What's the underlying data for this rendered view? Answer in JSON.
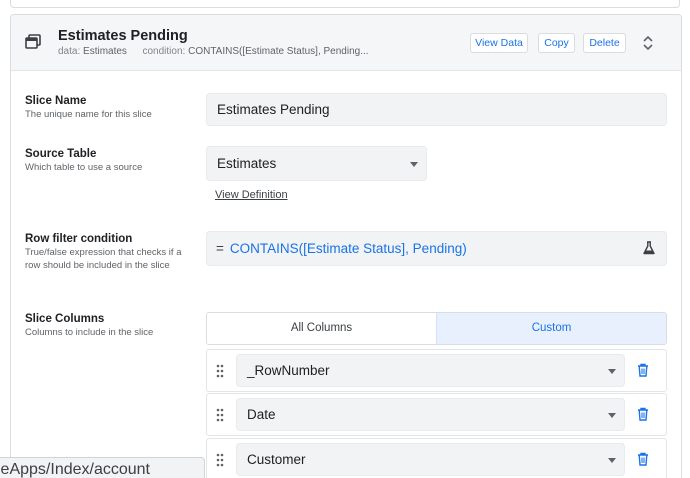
{
  "header": {
    "title": "Estimates Pending",
    "data_label": "data:",
    "data_value": "Estimates",
    "condition_label": "condition:",
    "condition_value": "CONTAINS([Estimate Status], Pending...",
    "buttons": {
      "view_data": "View Data",
      "copy": "Copy",
      "delete": "Delete"
    },
    "icons": {
      "slice": "slice-stack-icon",
      "expand": "unfold-icon"
    }
  },
  "fields": {
    "slice_name": {
      "label": "Slice Name",
      "hint": "The unique name for this slice",
      "value": "Estimates Pending"
    },
    "source_table": {
      "label": "Source Table",
      "hint": "Which table to use a source",
      "value": "Estimates",
      "link": "View Definition"
    },
    "row_filter": {
      "label": "Row filter condition",
      "hint": "True/false expression that checks if a row should be included in the slice",
      "prefix": "=",
      "value": "CONTAINS([Estimate Status], Pending)",
      "icon": "flask-icon"
    },
    "slice_columns": {
      "label": "Slice Columns",
      "hint": "Columns to include in the slice",
      "mode_all": "All Columns",
      "mode_custom": "Custom",
      "selected_mode": "Custom"
    }
  },
  "columns": [
    "_RowNumber",
    "Date",
    "Customer"
  ],
  "status_bar": {
    "url": "leApps/Index/account"
  },
  "colors": {
    "accent": "#1a73e8",
    "field_bg": "#f1f3f4",
    "header_bg": "#f5f6f7",
    "selected_bg": "#e8f0fe"
  }
}
